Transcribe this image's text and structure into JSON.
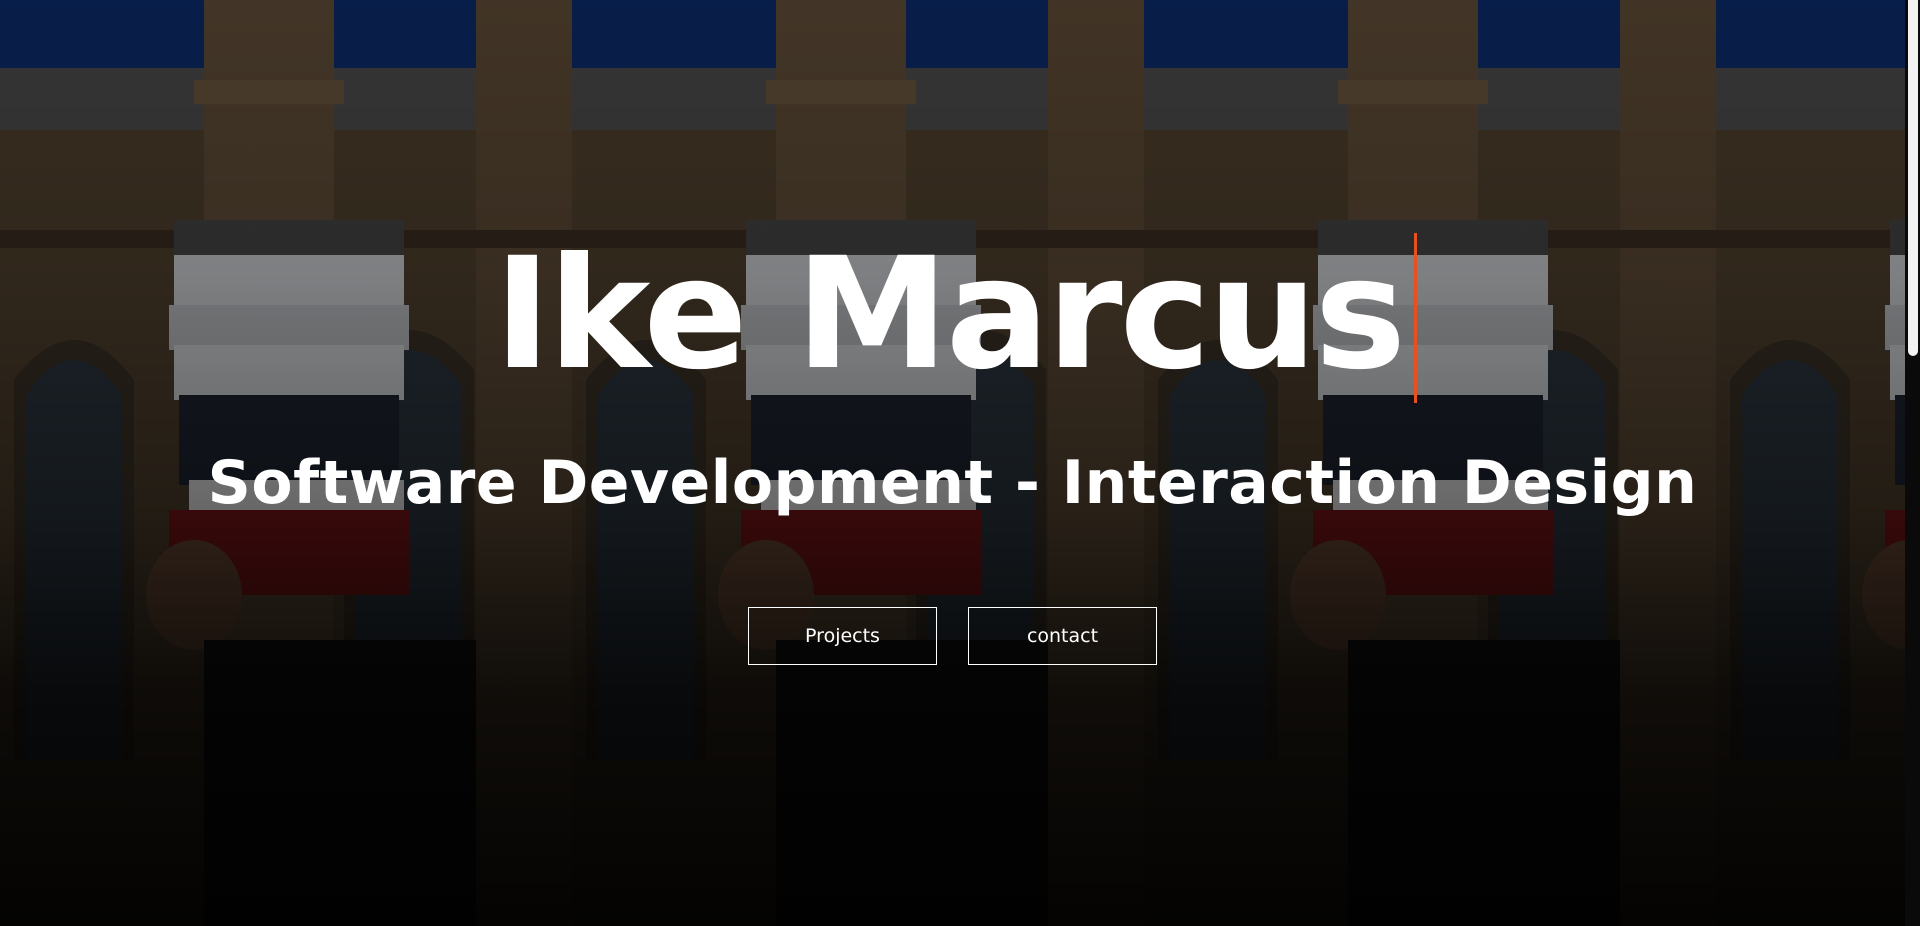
{
  "hero": {
    "title": "Ike Marcus",
    "subtitle": "Software Development - Interaction Design",
    "buttons": {
      "projects_label": "Projects",
      "contact_label": "contact"
    }
  },
  "colors": {
    "caret": "#e8501e",
    "text": "#ffffff",
    "sky": "#0b2a66",
    "background": "#000000"
  }
}
